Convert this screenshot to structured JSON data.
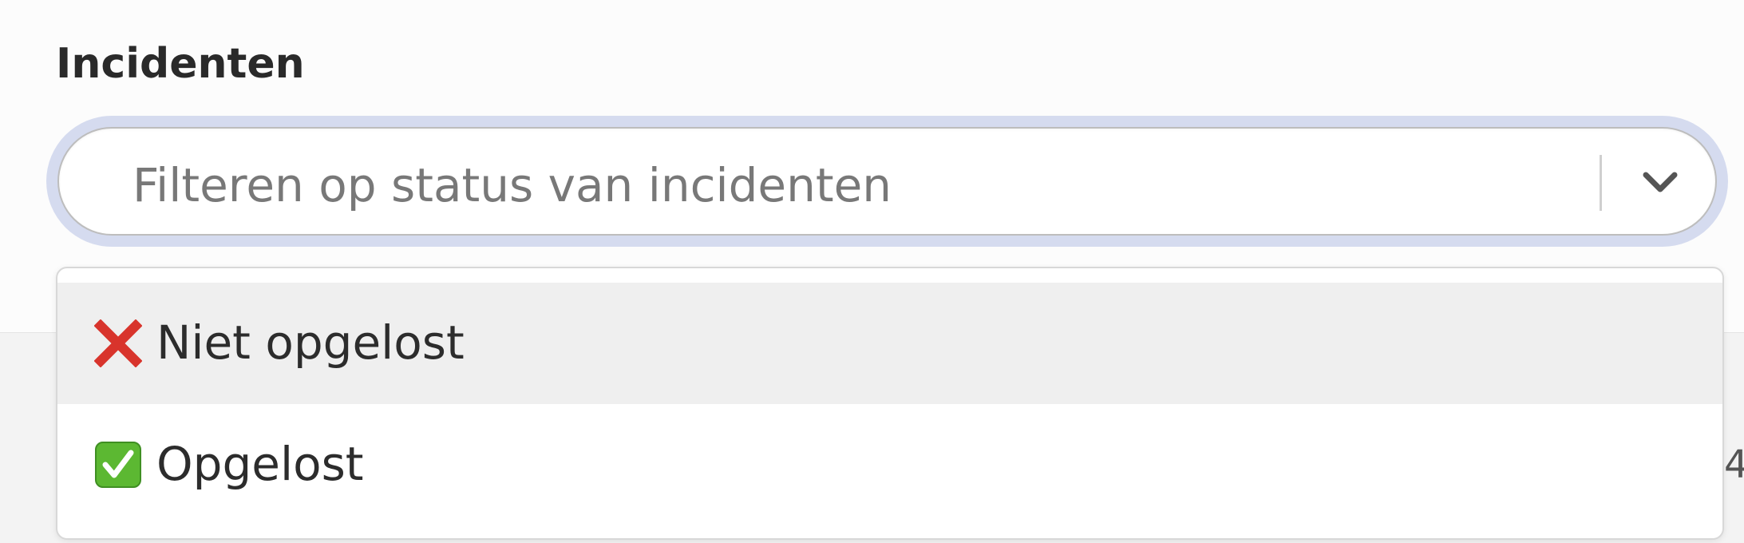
{
  "section": {
    "title": "Incidenten"
  },
  "select": {
    "placeholder": "Filteren op status van incidenten",
    "indicator_icon": "chevron-down-icon",
    "focus_ring_color": "#d5dbef"
  },
  "options": [
    {
      "icon": "red-cross-icon",
      "label": "Niet opgelost",
      "focused": true
    },
    {
      "icon": "green-check-icon",
      "label": "Opgelost",
      "focused": false
    }
  ],
  "edge_text": "4"
}
